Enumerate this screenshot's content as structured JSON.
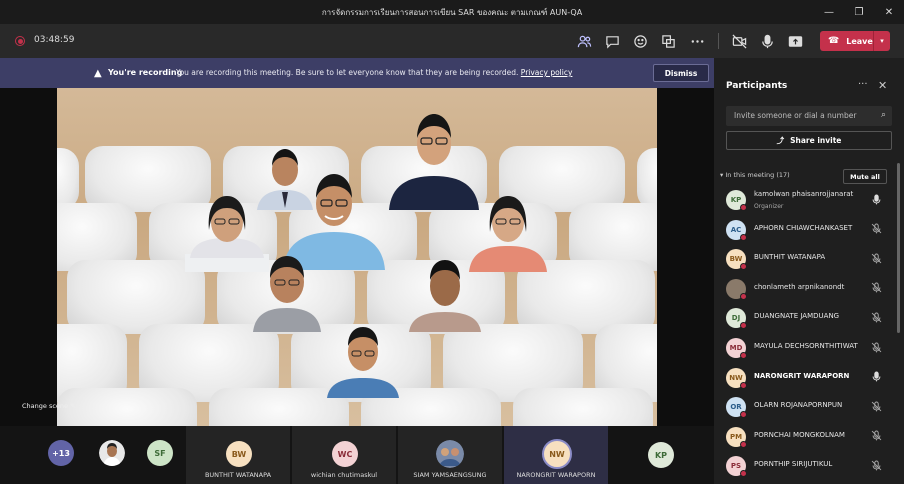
{
  "window": {
    "title": "การจัดกรรมการเรียนการสอนการเขียน SAR ของคณะ ตามเกณฑ์ AUN-QA"
  },
  "toolbar": {
    "timer": "03:48:59",
    "leave_label": "Leave"
  },
  "banner": {
    "title": "You're recording",
    "message": "You are recording this meeting. Be sure to let everyone know that they are being recorded.",
    "link": "Privacy policy",
    "dismiss_label": "Dismiss"
  },
  "stage": {
    "change_scene_label": "Change scene"
  },
  "bottom_tiles": [
    {
      "initials": "+13",
      "name": "",
      "color": "#6264a7"
    },
    {
      "initials": "",
      "name": "",
      "color": "#555555"
    },
    {
      "initials": "SF",
      "name": "",
      "color": "#cde4c7"
    },
    {
      "initials": "BW",
      "name": "BUNTHIT WATANAPA",
      "color": "#f7e0c0"
    },
    {
      "initials": "WC",
      "name": "wichian chutimaskul",
      "color": "#f3d2d4"
    },
    {
      "initials": "",
      "name": "SIAM YAMSAENGSUNG",
      "color": "#888888"
    },
    {
      "initials": "NW",
      "name": "NARONGRIT WARAPORN",
      "color": "#f7e0c0"
    },
    {
      "initials": "KP",
      "name": "",
      "color": "#dfe9d9"
    }
  ],
  "panel": {
    "title": "Participants",
    "invite_placeholder": "Invite someone or dial a number",
    "share_label": "Share invite",
    "in_meeting_label": "In this meeting (17)",
    "mute_all_label": "Mute all",
    "participants": [
      {
        "initials": "KP",
        "name": "kamolwan phaisanrojjanarat",
        "role": "Organizer",
        "color": "#dfe9d9",
        "fg": "#3d6b38",
        "mic": "on"
      },
      {
        "initials": "AC",
        "name": "APHORN CHIAWCHANKASET",
        "role": "",
        "color": "#cfe2f3",
        "fg": "#2c5d8a",
        "mic": "off"
      },
      {
        "initials": "BW",
        "name": "BUNTHIT WATANAPA",
        "role": "",
        "color": "#f7e0c0",
        "fg": "#8a5a1c",
        "mic": "off"
      },
      {
        "initials": "",
        "name": "chonlameth arpnikanondt",
        "role": "",
        "color": "#8a7a6a",
        "fg": "#ffffff",
        "mic": "off"
      },
      {
        "initials": "DJ",
        "name": "DUANGNATE JAMDUANG",
        "role": "",
        "color": "#dfe9d9",
        "fg": "#3d6b38",
        "mic": "off"
      },
      {
        "initials": "MD",
        "name": "MAYULA DECHSORNTHITIWAT",
        "role": "",
        "color": "#f3d2d4",
        "fg": "#8a2c38",
        "mic": "off"
      },
      {
        "initials": "NW",
        "name": "NARONGRIT WARAPORN",
        "role": "",
        "color": "#f7e0c0",
        "fg": "#8a5a1c",
        "mic": "on",
        "bold": true
      },
      {
        "initials": "OR",
        "name": "OLARN ROJANAPORNPUN",
        "role": "",
        "color": "#cfe2f3",
        "fg": "#2c5d8a",
        "mic": "off"
      },
      {
        "initials": "PM",
        "name": "PORNCHAI MONGKOLNAM",
        "role": "",
        "color": "#f7e0c0",
        "fg": "#8a5a1c",
        "mic": "off"
      },
      {
        "initials": "PS",
        "name": "PORNTHIP SIRIJUTIKUL",
        "role": "",
        "color": "#f3d2d4",
        "fg": "#8a2c38",
        "mic": "off"
      }
    ]
  },
  "colors": {
    "accent": "#6264a7",
    "leave": "#c4314b",
    "banner": "#3d3e66"
  }
}
